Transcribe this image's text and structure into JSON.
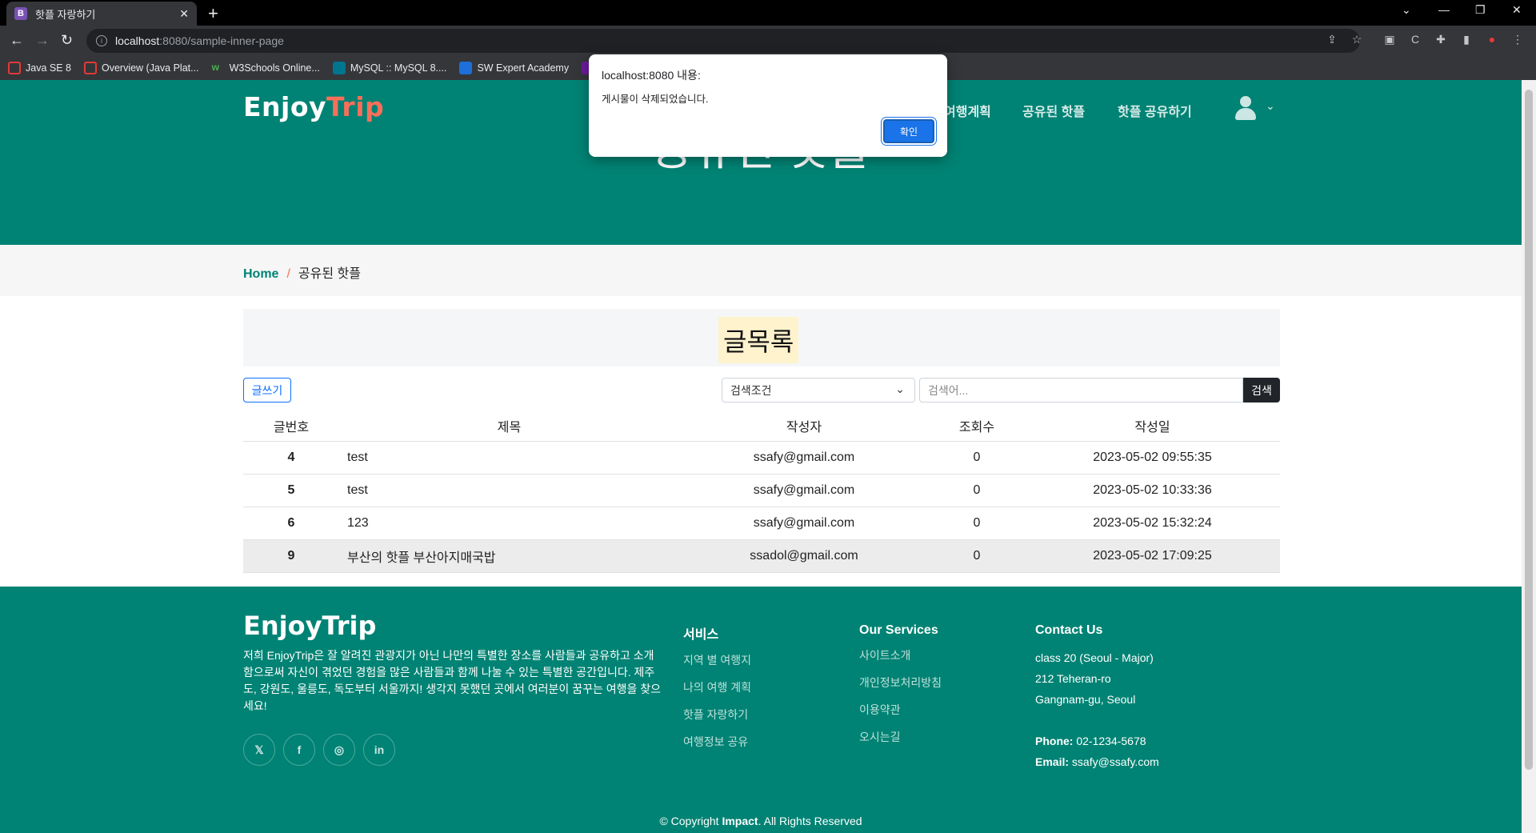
{
  "browser": {
    "tab_title": "핫플 자랑하기",
    "tab_favicon": "B",
    "url_host": "localhost",
    "url_path": ":8080/sample-inner-page",
    "bookmarks": [
      {
        "label": "Java SE 8",
        "color": "#e53935"
      },
      {
        "label": "Overview (Java Plat...",
        "color": "#e53935"
      },
      {
        "label": "W3Schools Online...",
        "color": "#4caf50"
      },
      {
        "label": "MySQL :: MySQL 8....",
        "color": "#00758f"
      },
      {
        "label": "SW Expert Academy",
        "color": "#1e6fd9"
      }
    ]
  },
  "header": {
    "logo_main": "EnjoyTrip",
    "logo_prefix": "Enjoy",
    "logo_accent": "Trip",
    "nav": [
      "여행계획",
      "공유된 핫플",
      "핫플 공유하기"
    ]
  },
  "hero": {
    "title": "공유된 핫플"
  },
  "breadcrumb": {
    "home": "Home",
    "separator": "/",
    "current": "공유된 핫플"
  },
  "board": {
    "title": "글목록",
    "write_button": "글쓰기",
    "search_condition": "검색조건",
    "search_placeholder": "검색어...",
    "search_button": "검색",
    "columns": [
      "글번호",
      "제목",
      "작성자",
      "조회수",
      "작성일"
    ],
    "rows": [
      {
        "no": "4",
        "title": "test",
        "author": "ssafy@gmail.com",
        "views": "0",
        "date": "2023-05-02 09:55:35"
      },
      {
        "no": "5",
        "title": "test",
        "author": "ssafy@gmail.com",
        "views": "0",
        "date": "2023-05-02 10:33:36"
      },
      {
        "no": "6",
        "title": "123",
        "author": "ssafy@gmail.com",
        "views": "0",
        "date": "2023-05-02 15:32:24"
      },
      {
        "no": "9",
        "title": "부산의 핫플 부산아지매국밥",
        "author": "ssadol@gmail.com",
        "views": "0",
        "date": "2023-05-02 17:09:25"
      }
    ]
  },
  "footer": {
    "logo": "EnjoyTrip",
    "description": "저희 EnjoyTrip은 잘 알려진 관광지가 아닌 나만의 특별한 장소를 사람들과 공유하고 소개함으로써 자신이 겪었던 경험을 많은 사람들과 함께 나눌 수 있는 특별한 공간입니다. 제주도, 강원도, 울릉도, 독도부터 서울까지! 생각지 못했던 곳에서 여러분이 꿈꾸는 여행을 찾으세요!",
    "social": [
      "twitter-icon",
      "facebook-icon",
      "instagram-icon",
      "linkedin-icon"
    ],
    "services_title": "서비스",
    "services": [
      "지역 별 여행지",
      "나의 여행 계획",
      "핫플 자랑하기",
      "여행정보 공유"
    ],
    "our_services_title": "Our Services",
    "our_services": [
      "사이트소개",
      "개인정보처리방침",
      "이용약관",
      "오시는길"
    ],
    "contact_title": "Contact Us",
    "address": [
      "class 20 (Seoul - Major)",
      "212 Teheran-ro",
      "Gangnam-gu, Seoul"
    ],
    "phone_label": "Phone:",
    "phone": "02-1234-5678",
    "email_label": "Email:",
    "email": "ssafy@ssafy.com",
    "copyright_prefix": "© Copyright",
    "copyright_brand": "Impact",
    "copyright_suffix": ". All Rights Reserved"
  },
  "alert": {
    "title": "localhost:8080 내용:",
    "message": "게시물이 삭제되었습니다.",
    "ok_button": "확인"
  },
  "colors": {
    "brand": "#008374",
    "accent": "#f96f59"
  }
}
